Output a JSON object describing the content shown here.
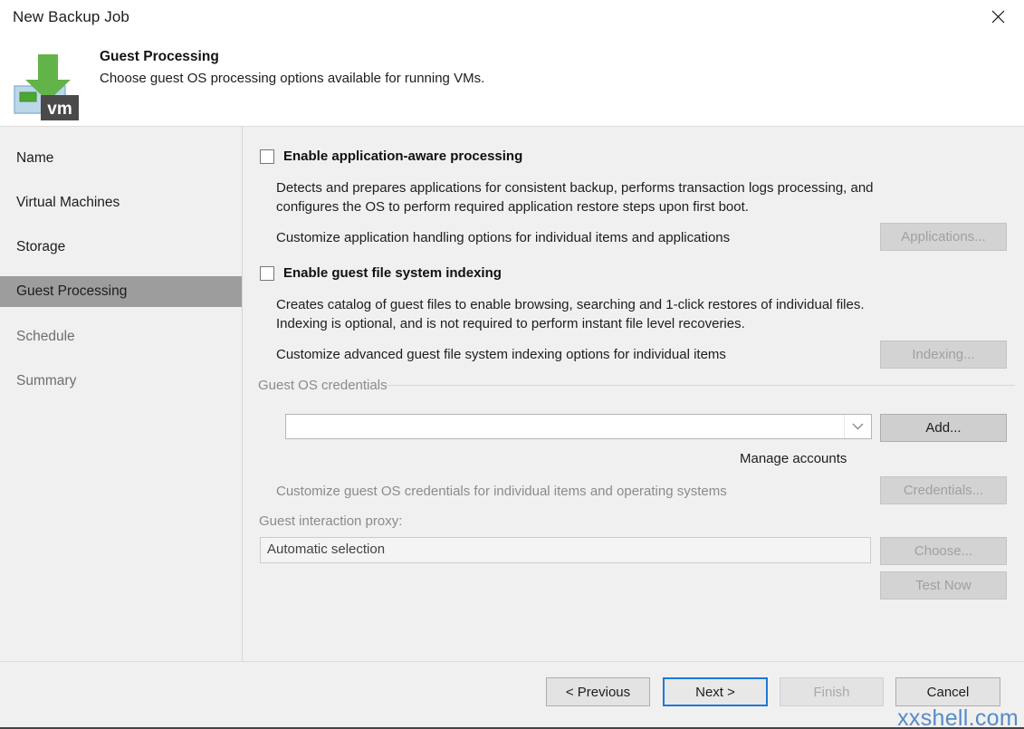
{
  "window": {
    "title": "New Backup Job",
    "close_icon": "close-icon"
  },
  "header": {
    "icon": "vm-backup-icon",
    "title": "Guest Processing",
    "subtitle": "Choose guest OS processing options available for running VMs."
  },
  "sidebar": {
    "items": [
      {
        "label": "Name",
        "state": "normal"
      },
      {
        "label": "Virtual Machines",
        "state": "normal"
      },
      {
        "label": "Storage",
        "state": "normal"
      },
      {
        "label": "Guest Processing",
        "state": "selected"
      },
      {
        "label": "Schedule",
        "state": "dim"
      },
      {
        "label": "Summary",
        "state": "dim"
      }
    ]
  },
  "main": {
    "app_aware": {
      "checkbox_label": "Enable application-aware processing",
      "checked": false,
      "description_line1": "Detects and prepares applications for consistent backup, performs transaction logs processing, and",
      "description_line2": "configures the OS to perform required application restore steps upon first boot.",
      "customize_text": "Customize application handling options for individual items and applications",
      "button_label": "Applications...",
      "button_enabled": false
    },
    "indexing": {
      "checkbox_label": "Enable guest file system indexing",
      "checked": false,
      "description_line1": "Creates catalog of guest files to enable browsing, searching and 1-click restores of individual files.",
      "description_line2": "Indexing is optional, and is not required to perform instant file level recoveries.",
      "customize_text": "Customize advanced guest file system indexing options for individual items",
      "button_label": "Indexing...",
      "button_enabled": false
    },
    "credentials_group": {
      "group_label": "Guest OS credentials",
      "combo_value": "",
      "combo_arrow_icon": "chevron-down-icon",
      "add_button_label": "Add...",
      "add_button_enabled": true,
      "manage_accounts_link": "Manage accounts",
      "customize_text": "Customize guest OS credentials for individual items and operating systems",
      "credentials_button_label": "Credentials...",
      "credentials_button_enabled": false
    },
    "proxy": {
      "label": "Guest interaction proxy:",
      "value": "Automatic selection",
      "choose_button_label": "Choose...",
      "choose_button_enabled": false,
      "test_button_label": "Test Now",
      "test_button_enabled": false
    }
  },
  "footer": {
    "previous_label": "< Previous",
    "next_label": "Next >",
    "finish_label": "Finish",
    "cancel_label": "Cancel",
    "finish_enabled": false,
    "next_focused": true
  },
  "watermark": {
    "text": "xxshell.com",
    "color": "#4f86c6"
  },
  "colors": {
    "accent": "#1e78d7",
    "selected_nav": "#9d9d9d",
    "pane_background": "#f0f0f0",
    "icon_green": "#6db34a",
    "icon_blue": "#bcd7ea",
    "icon_dark": "#4a4a4a"
  }
}
